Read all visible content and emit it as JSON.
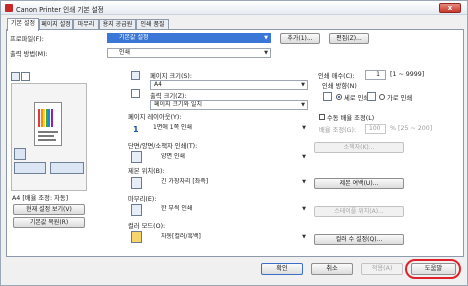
{
  "window": {
    "title": "Canon Printer 인쇄 기본 설정",
    "close_label": "x"
  },
  "tabs": [
    {
      "label": "기본 설정",
      "active": true
    },
    {
      "label": "페이지 설정"
    },
    {
      "label": "마무리"
    },
    {
      "label": "용지 공급원"
    },
    {
      "label": "인쇄 품질"
    }
  ],
  "profile": {
    "label": "프로파일(F):",
    "value": "기본값 설정",
    "add_label": "추가(1)...",
    "edit_label": "편집(Z)..."
  },
  "output_method": {
    "label": "출력 방법(M):",
    "value": "인쇄"
  },
  "preview": {
    "caption": "A4 [배율 조정: 자동]",
    "view_settings_label": "현재 설정 보기(V)",
    "restore_defaults_label": "기본값 복원(R)"
  },
  "page_size": {
    "label": "페이지 크기(S):",
    "value": "A4"
  },
  "output_size": {
    "label": "출력 크기(Z):",
    "value": "페이지 크기와 일치"
  },
  "page_layout": {
    "label": "페이지 레이아웃(Y):",
    "value": "1면에 1쪽 인쇄",
    "icon_text": "1"
  },
  "print_style": {
    "label": "단면/양면/소책자 인쇄(T):",
    "value": "양면 인쇄"
  },
  "binding": {
    "label": "제본 위치(B):",
    "value": "긴 가장자리 [좌측]",
    "button_label": "제본 여백(U)..."
  },
  "finishing": {
    "label": "마무리(E):",
    "value": "한 부씩 인쇄",
    "button_label": "스테이플 위치(A)..."
  },
  "color_mode": {
    "label": "컬러 모드(O):",
    "value": "자동[컬러/흑백]",
    "button_label": "컬러 수 설정(Q)..."
  },
  "copies": {
    "label": "인쇄 매수(C):",
    "value": "1",
    "range": "[1 ~ 9999]"
  },
  "orientation": {
    "label": "인쇄 방향(N)",
    "portrait_label": "세로 인쇄",
    "landscape_label": "가로 인쇄",
    "selected": "portrait"
  },
  "manual_scaling": {
    "label": "수동 배율 조정(L)",
    "checked": false,
    "ratio_label": "배율 조정(G):",
    "ratio_value": "100",
    "ratio_range": "% [25 ~ 200]"
  },
  "booklet_button": "소책자(K)...",
  "footer": {
    "ok": "확인",
    "cancel": "취소",
    "apply": "적용(A)",
    "help": "도움말"
  },
  "colors": {
    "accent": "#3b77d6",
    "highlight": "#e0202a",
    "icon_red": "#c62828"
  }
}
